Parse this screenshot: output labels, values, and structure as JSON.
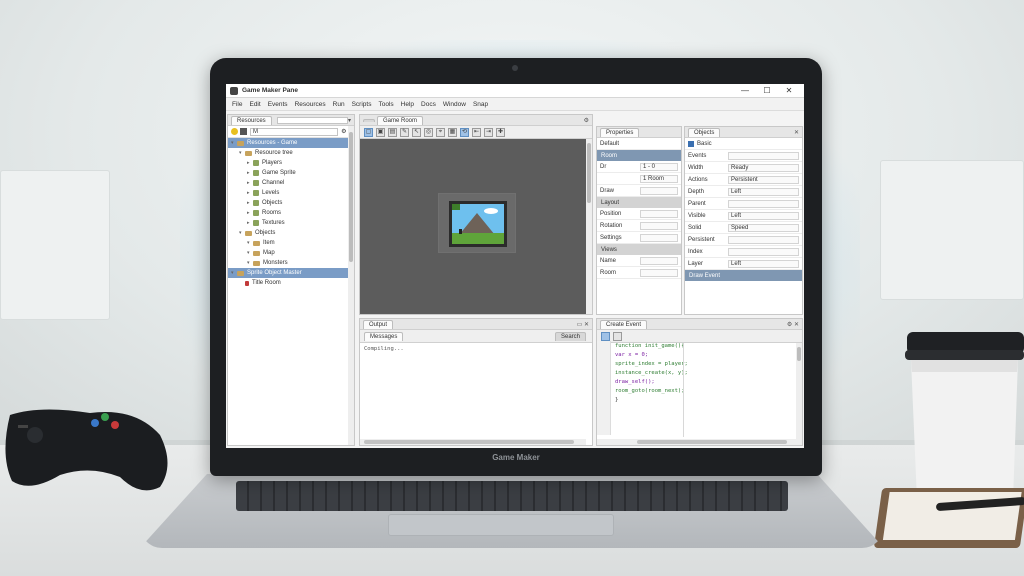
{
  "window": {
    "title": "Game Maker Pane",
    "controls": [
      "—",
      "☐",
      "✕"
    ]
  },
  "menu": [
    "File",
    "Edit",
    "Events",
    "Resources",
    "Run",
    "Scripts",
    "Tools",
    "Help",
    "Docs",
    "Window",
    "Snap"
  ],
  "resources_panel": {
    "tab": "Resources",
    "search_placeholder": "",
    "search_value": "M",
    "items": [
      {
        "label": "Resources - Game",
        "indent": 0,
        "selected": true,
        "kind": "root"
      },
      {
        "label": "Resource tree",
        "indent": 1,
        "selected": false,
        "kind": "folder"
      },
      {
        "label": "Players",
        "indent": 2,
        "selected": false,
        "kind": "file"
      },
      {
        "label": "Game Sprite",
        "indent": 2,
        "selected": false,
        "kind": "file"
      },
      {
        "label": "Channel",
        "indent": 2,
        "selected": false,
        "kind": "file"
      },
      {
        "label": "Levels",
        "indent": 2,
        "selected": false,
        "kind": "file"
      },
      {
        "label": "Objects",
        "indent": 2,
        "selected": false,
        "kind": "file"
      },
      {
        "label": "Rooms",
        "indent": 2,
        "selected": false,
        "kind": "file"
      },
      {
        "label": "Textures",
        "indent": 2,
        "selected": false,
        "kind": "file"
      },
      {
        "label": "Objects",
        "indent": 1,
        "selected": false,
        "kind": "folder"
      },
      {
        "label": "Item",
        "indent": 2,
        "selected": false,
        "kind": "folder"
      },
      {
        "label": "Map",
        "indent": 2,
        "selected": false,
        "kind": "folder"
      },
      {
        "label": "Monsters",
        "indent": 2,
        "selected": false,
        "kind": "folder"
      },
      {
        "label": "Sprite Object Master",
        "indent": 0,
        "selected": true,
        "kind": "root"
      },
      {
        "label": "Title Room",
        "indent": 1,
        "selected": false,
        "kind": "room"
      }
    ]
  },
  "room_editor": {
    "tab": "Game Room",
    "tools": [
      "▢",
      "▣",
      "▤",
      "✎",
      "↖",
      "◎",
      "⌖",
      "▦",
      "⟲",
      "⇤",
      "⇥",
      "✚"
    ]
  },
  "properties_panel": {
    "tab": "Properties",
    "header": "Default",
    "section_title": "Room",
    "rows": [
      {
        "label": "Dr",
        "value": "1 - 0"
      },
      {
        "label": "",
        "value": "1 Room"
      },
      {
        "label": "Draw",
        "value": ""
      }
    ],
    "section2_title": "Layout",
    "rows2": [
      {
        "label": "Position",
        "value": ""
      },
      {
        "label": "Rotation",
        "value": ""
      },
      {
        "label": "Settings",
        "value": ""
      }
    ],
    "section3_title": "Views",
    "rows3": [
      {
        "label": "Name",
        "value": ""
      },
      {
        "label": "Room",
        "value": ""
      }
    ]
  },
  "settings_panel": {
    "tab": "Objects",
    "header": "Basic",
    "rows": [
      {
        "label": "Events",
        "value": ""
      },
      {
        "label": "Width",
        "value": "Ready"
      },
      {
        "label": "Actions",
        "value": "Persistent"
      },
      {
        "label": "Depth",
        "value": "Left"
      },
      {
        "label": "Parent",
        "value": ""
      },
      {
        "label": "Visible",
        "value": "Left"
      },
      {
        "label": "Solid",
        "value": "Speed"
      },
      {
        "label": "Persistent",
        "value": ""
      },
      {
        "label": "Index",
        "value": ""
      },
      {
        "label": "Layer",
        "value": "Left"
      }
    ],
    "footer": "Draw Event"
  },
  "output_panel": {
    "tab": "Output",
    "tab2": "Messages",
    "tab3": "Search",
    "lines": [
      "Compiling..."
    ]
  },
  "code_panel": {
    "tab": "Create Event",
    "lines": [
      {
        "text": "function init_game(){",
        "color": "#2e7d32"
      },
      {
        "text": "  var x = 0;",
        "color": "#7b1fa2"
      },
      {
        "text": "  sprite_index = player;",
        "color": "#2e7d32"
      },
      {
        "text": "  instance_create(x, y);",
        "color": "#2e7d32"
      },
      {
        "text": "  draw_self();",
        "color": "#7b1fa2"
      },
      {
        "text": "  room_goto(room_next);",
        "color": "#2e7d32"
      },
      {
        "text": "}",
        "color": "#333333"
      }
    ]
  },
  "laptop": {
    "brand": "Game Maker"
  },
  "colors": {
    "selection": "#7a9cc6",
    "section_blue": "#7f97b2",
    "accent_glow": "#78c8f0"
  }
}
